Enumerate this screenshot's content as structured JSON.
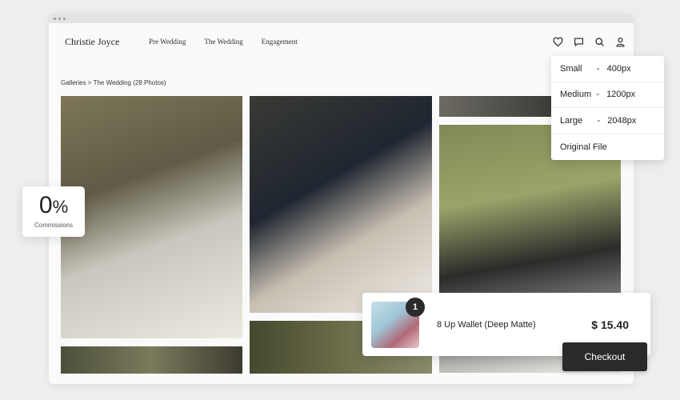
{
  "nav": {
    "brand": "Christie Joyce",
    "menu": [
      "Pre Wedding",
      "The Wedding",
      "Engagement"
    ],
    "icons": [
      "heart-icon",
      "chat-icon",
      "search-icon",
      "user-icon"
    ]
  },
  "breadcrumb": {
    "root": "Galleries",
    "separator": " > ",
    "current": "The Wedding (28 Photos)"
  },
  "sizes": [
    "Small      -   400px",
    "Medium  -   1200px",
    "Large      -   2048px",
    "Original File"
  ],
  "commission": {
    "value": "0",
    "unit": "%",
    "label": "Commissions"
  },
  "cart": {
    "count": "1",
    "item": "8 Up Wallet (Deep Matte)",
    "price": "$ 15.40"
  },
  "checkout_label": "Checkout"
}
